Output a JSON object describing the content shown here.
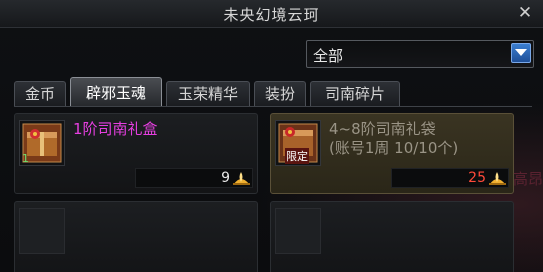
{
  "window": {
    "title": "未央幻境云珂",
    "close_label": "✕"
  },
  "filter": {
    "selected": "全部"
  },
  "tabs": [
    {
      "label": "金币",
      "active": false
    },
    {
      "label": "辟邪玉魂",
      "active": true
    },
    {
      "label": "玉荣精华",
      "active": false
    },
    {
      "label": "装扮",
      "active": false
    },
    {
      "label": "司南碎片",
      "active": false
    }
  ],
  "items": [
    {
      "name": "1阶司南礼盒",
      "name_color": "#e53fe0",
      "count": "1",
      "price": "9",
      "price_color": "#e8e8e8"
    },
    {
      "name": "4~8阶司南礼袋",
      "sub": "(账号1周 10/10个)",
      "name_color": "#9a9486",
      "badge": "限定",
      "price": "25",
      "price_color": "#ff4a3a"
    }
  ],
  "background_text": "高昂",
  "colors": {
    "accent_blue": "#2f6dc0",
    "currency_gold": "#f0b030"
  }
}
